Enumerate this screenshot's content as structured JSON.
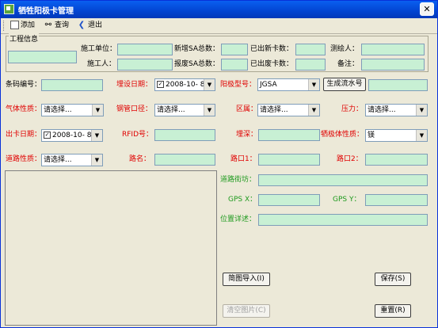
{
  "window": {
    "title": "牺牲阳极卡管理",
    "close_glyph": "✕"
  },
  "toolbar": {
    "add_label": "添加",
    "query_label": "查询",
    "exit_label": "退出"
  },
  "project": {
    "group_title": "工程信息",
    "construction_unit_label": "施工单位：",
    "constructor_label": "施工人：",
    "new_sa_label": "新增SA总数：",
    "scrap_sa_label": "报废SA总数：",
    "new_card_label": "已出新卡数：",
    "scrap_card_label": "已出废卡数：",
    "surveyor_label": "测绘人：",
    "remark_label": "备注："
  },
  "form": {
    "barcode_label": "条码编号：",
    "bury_date_label": "埋设日期：",
    "bury_date_value": "2008-10- 8",
    "anode_model_label": "阳极型号：",
    "anode_model_value": "JGSA",
    "gen_serial_button": "生成流水号",
    "gas_label": "气体性质：",
    "gas_value": "请选择...",
    "pipe_label": "钢管口径：",
    "pipe_value": "请选择...",
    "district_label": "区属：",
    "district_value": "请选择...",
    "pressure_label": "压力：",
    "pressure_value": "请选择...",
    "card_date_label": "出卡日期：",
    "card_date_value": "2008-10- 8",
    "rfid_label": "RFID号：",
    "depth_label": "埋深：",
    "anode_material_label": "牺极体性质：",
    "anode_material_value": "镁",
    "road_type_label": "道路性质：",
    "road_type_value": "请选择...",
    "road_name_label": "路名：",
    "road1_label": "路口1：",
    "road2_label": "路口2：",
    "lane_label": "道路街坊：",
    "gps_x_label": "GPS X：",
    "gps_y_label": "GPS Y：",
    "location_label": "位置详述："
  },
  "buttons": {
    "import_label": "简图导入(I)",
    "clear_label": "清空图片(C)",
    "save_label": "保存(S)",
    "reset_label": "重置(R)"
  }
}
